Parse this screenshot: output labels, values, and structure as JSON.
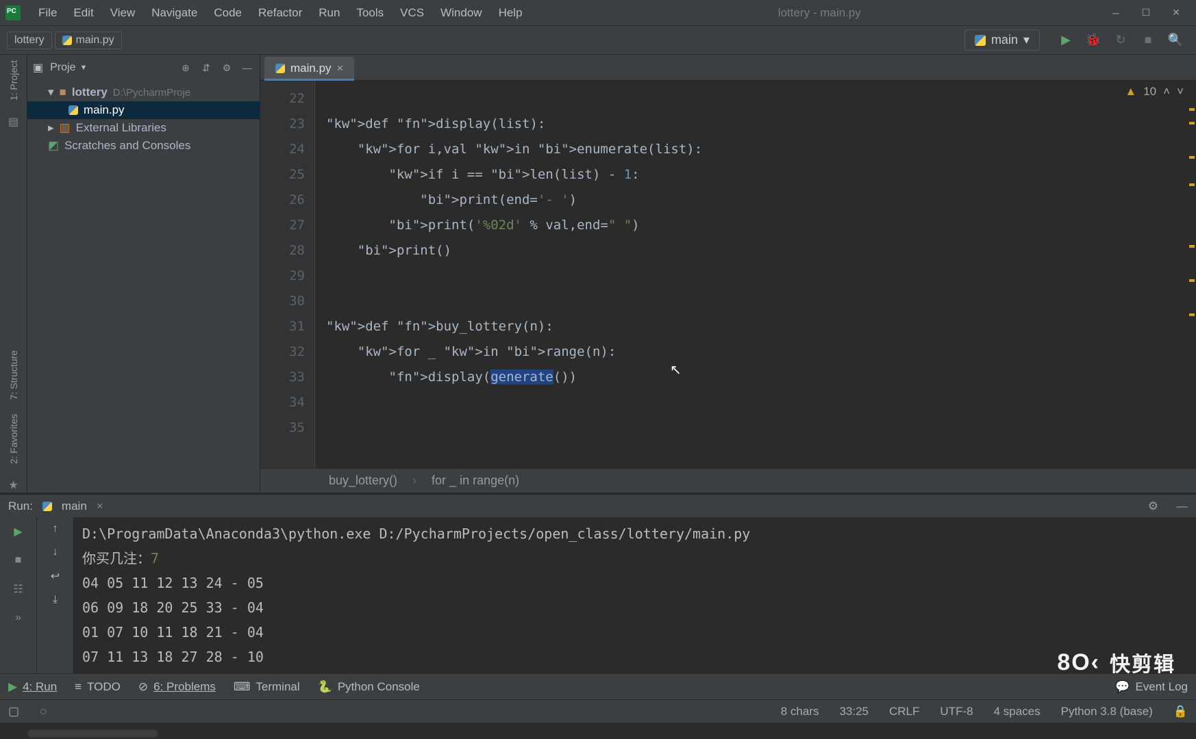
{
  "window": {
    "title": "lottery - main.py"
  },
  "menu": [
    "File",
    "Edit",
    "View",
    "Navigate",
    "Code",
    "Refactor",
    "Run",
    "Tools",
    "VCS",
    "Window",
    "Help"
  ],
  "breadcrumb": {
    "root": "lottery",
    "file": "main.py"
  },
  "runConfig": {
    "name": "main"
  },
  "project": {
    "title": "Project",
    "rootName": "lottery",
    "rootPath": "D:\\PycharmProje",
    "file": "main.py",
    "external": "External Libraries",
    "scratches": "Scratches and Consoles"
  },
  "editor": {
    "tab": "main.py",
    "firstLine": 22,
    "lines": [
      "",
      "def display(list):",
      "    for i,val in enumerate(list):",
      "        if i == len(list) - 1:",
      "            print(end='- ')",
      "        print('%02d' % val,end=\" \")",
      "    print()",
      "",
      "",
      "def buy_lottery(n):",
      "    for _ in range(n):",
      "        display(generate())",
      "",
      ""
    ],
    "inspections": {
      "count": "10"
    },
    "crumb1": "buy_lottery()",
    "crumb2": "for _ in range(n)"
  },
  "run": {
    "label": "Run:",
    "config": "main",
    "cmd": "D:\\ProgramData\\Anaconda3\\python.exe D:/PycharmProjects/open_class/lottery/main.py",
    "prompt": "你买几注：",
    "promptVal": "7",
    "rows": [
      "04 05 11 12 13 24 - 05",
      "06 09 18 20 25 33 - 04",
      "01 07 10 11 18 21 - 04",
      "07 11 13 18 27 28 - 10"
    ]
  },
  "bottom": {
    "run": "4: Run",
    "todo": "TODO",
    "problems": "6: Problems",
    "terminal": "Terminal",
    "pyconsole": "Python Console",
    "eventlog": "Event Log"
  },
  "status": {
    "chars": "8 chars",
    "pos": "33:25",
    "lineEnd": "CRLF",
    "encoding": "UTF-8",
    "indent": "4 spaces",
    "interpreter": "Python 3.8 (base)"
  },
  "sideLabels": {
    "project": "1: Project",
    "structure": "7: Structure",
    "favorites": "2: Favorites"
  },
  "watermark": "快剪辑"
}
